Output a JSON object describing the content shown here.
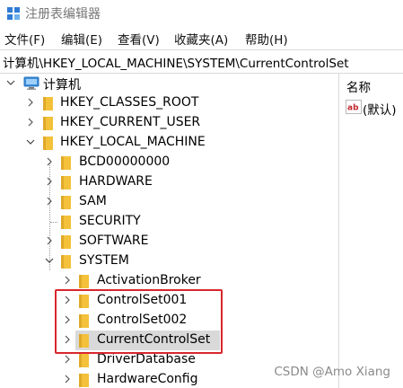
{
  "window": {
    "title": "注册表编辑器"
  },
  "menu": [
    "文件(F)",
    "编辑(E)",
    "查看(V)",
    "收藏夹(A)",
    "帮助(H)"
  ],
  "address": "计算机\\HKEY_LOCAL_MACHINE\\SYSTEM\\CurrentControlSet",
  "tree": [
    {
      "label": "计算机",
      "icon": "computer-icon",
      "expanded": true
    },
    {
      "label": "HKEY_CLASSES_ROOT",
      "icon": "folder-icon"
    },
    {
      "label": "HKEY_CURRENT_USER",
      "icon": "folder-icon"
    },
    {
      "label": "HKEY_LOCAL_MACHINE",
      "icon": "folder-icon",
      "expanded": true
    },
    {
      "label": "BCD00000000",
      "icon": "folder-icon"
    },
    {
      "label": "HARDWARE",
      "icon": "folder-icon"
    },
    {
      "label": "SAM",
      "icon": "folder-icon"
    },
    {
      "label": "SECURITY",
      "icon": "folder-icon"
    },
    {
      "label": "SOFTWARE",
      "icon": "folder-icon"
    },
    {
      "label": "SYSTEM",
      "icon": "folder-icon",
      "expanded": true
    },
    {
      "label": "ActivationBroker",
      "icon": "folder-icon"
    },
    {
      "label": "ControlSet001",
      "icon": "folder-icon"
    },
    {
      "label": "ControlSet002",
      "icon": "folder-icon"
    },
    {
      "label": "CurrentControlSet",
      "icon": "folder-icon",
      "selected": true
    },
    {
      "label": "DriverDatabase",
      "icon": "folder-icon"
    },
    {
      "label": "HardwareConfig",
      "icon": "folder-icon"
    }
  ],
  "right_pane": {
    "column_header": "名称",
    "value_name": "(默认)",
    "value_icon": "string-value-icon"
  },
  "watermark": "CSDN @Amo Xiang",
  "colors": {
    "folder": "#f3c13a",
    "highlight_border": "#d9262d",
    "selection": "#d9d9d9"
  }
}
